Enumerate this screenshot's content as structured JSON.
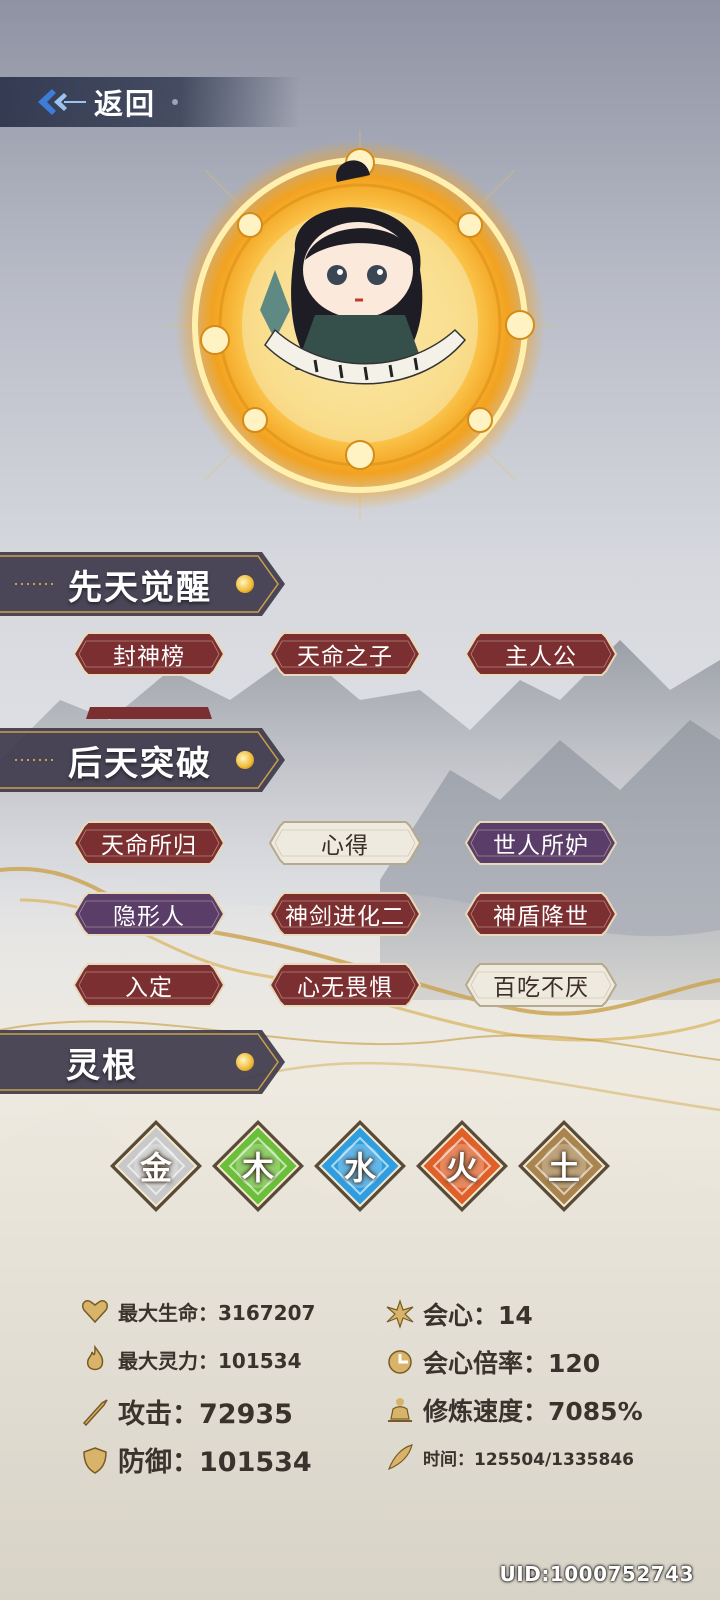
{
  "header": {
    "back_label": "返回"
  },
  "sections": {
    "innate": "先天觉醒",
    "acquired": "后天突破",
    "roots": "灵根"
  },
  "innate_tags": [
    {
      "label": "封神榜",
      "style": "red"
    },
    {
      "label": "天命之子",
      "style": "red"
    },
    {
      "label": "主人公",
      "style": "red"
    }
  ],
  "acquired_tags": [
    {
      "label": "天命所归",
      "style": "red"
    },
    {
      "label": "心得",
      "style": "cream"
    },
    {
      "label": "世人所妒",
      "style": "purple"
    },
    {
      "label": "隐形人",
      "style": "purple"
    },
    {
      "label": "神剑进化二",
      "style": "red"
    },
    {
      "label": "神盾降世",
      "style": "red"
    },
    {
      "label": "入定",
      "style": "red"
    },
    {
      "label": "心无畏惧",
      "style": "red"
    },
    {
      "label": "百吃不厌",
      "style": "cream"
    }
  ],
  "roots": [
    {
      "char": "金",
      "color": "#c9c9c9"
    },
    {
      "char": "木",
      "color": "#6cbf3a"
    },
    {
      "char": "水",
      "color": "#2f9ee0"
    },
    {
      "char": "火",
      "color": "#e0602a"
    },
    {
      "char": "土",
      "color": "#a9844f"
    }
  ],
  "stats": {
    "max_hp": "最大生命：3167207",
    "max_sp": "最大灵力：101534",
    "attack": "攻击：72935",
    "defense": "防御：101534",
    "crit": "会心：14",
    "crit_rate": "会心倍率：120",
    "cultivation": "修炼速度：7085%",
    "time": "时间：125504/1335846"
  },
  "uid": "UID:1000752743",
  "colors": {
    "tag_red": "#7c2f30",
    "tag_purple": "#5a3d68",
    "tag_cream": "#efeadf",
    "banner": "#3e3a4c",
    "gold": "#d6a64a"
  }
}
